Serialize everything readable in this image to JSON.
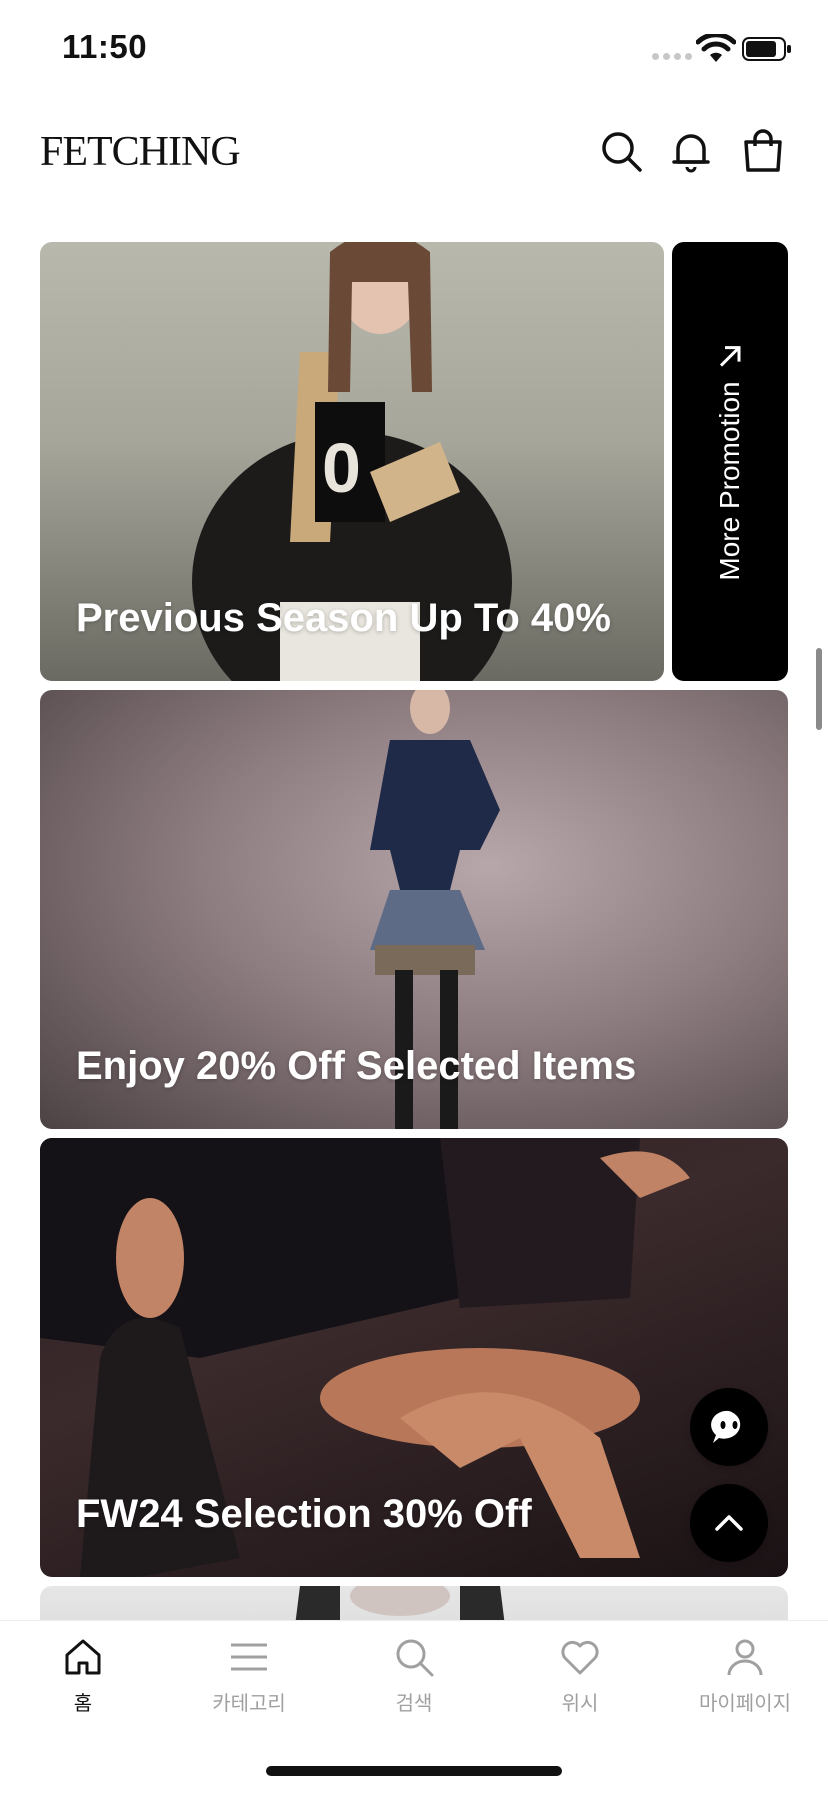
{
  "status_bar": {
    "time": "11:50"
  },
  "header": {
    "logo": "FETCHING",
    "icons": [
      "search-icon",
      "bell-icon",
      "shopping-bag-icon"
    ]
  },
  "banners": [
    {
      "caption": "Previous Season Up To 40%"
    },
    {
      "caption": "Enjoy 20% Off Selected Items"
    },
    {
      "caption": "FW24 Selection 30% Off"
    }
  ],
  "more_promotion": {
    "label": "More Promotion",
    "icon": "arrow-up-right-icon"
  },
  "floating": {
    "chat_icon": "chat-bot-icon",
    "top_icon": "chevron-up-icon"
  },
  "tabbar": {
    "items": [
      {
        "label": "홈",
        "icon": "home-icon",
        "active": true
      },
      {
        "label": "카테고리",
        "icon": "menu-icon",
        "active": false
      },
      {
        "label": "검색",
        "icon": "search-icon",
        "active": false
      },
      {
        "label": "위시",
        "icon": "heart-icon",
        "active": false
      },
      {
        "label": "마이페이지",
        "icon": "user-icon",
        "active": false
      }
    ]
  },
  "colors": {
    "active": "#111111",
    "inactive": "#a0a0a0",
    "promo_bg": "#000000"
  }
}
